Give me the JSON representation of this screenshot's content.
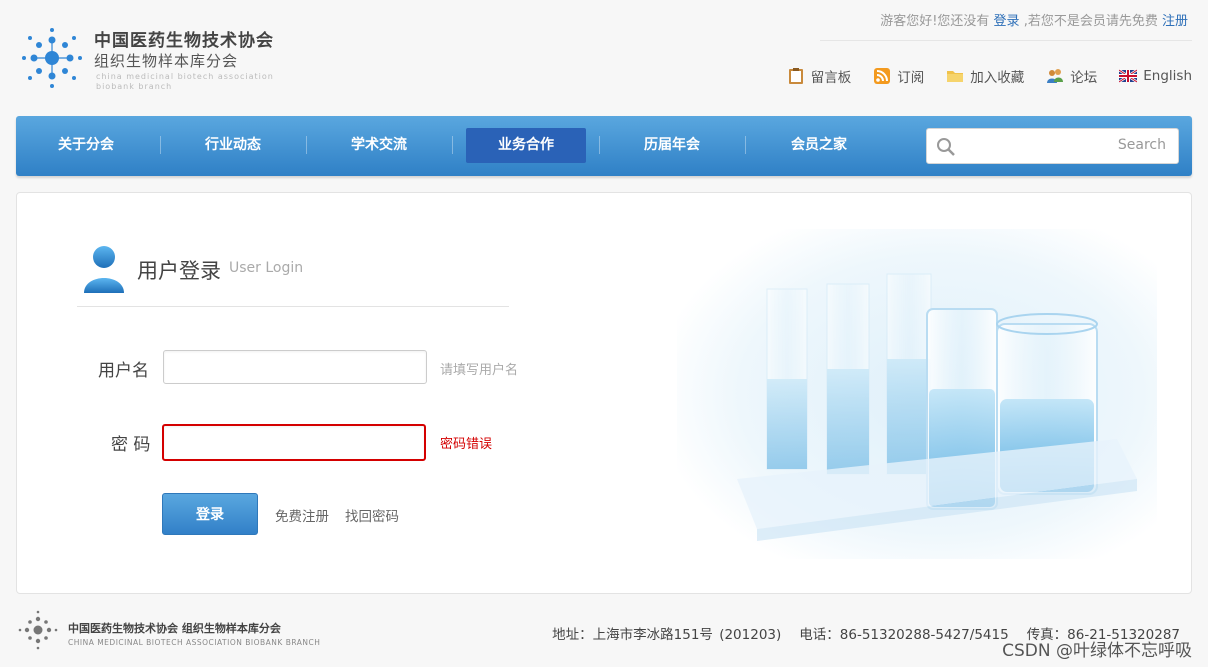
{
  "logo": {
    "cn_line1": "中国医药生物技术协会",
    "cn_line2": "组织生物样本库分会",
    "en_line1": "china medicinal biotech association",
    "en_line2": "biobank branch"
  },
  "topbar": {
    "greeting": "游客您好!您还没有",
    "login_link": "登录",
    "middle": ",若您不是会员请先免费",
    "register_link": "注册"
  },
  "toollinks": [
    {
      "label": "留言板",
      "icon": "message-board-icon"
    },
    {
      "label": "订阅",
      "icon": "rss-icon"
    },
    {
      "label": "加入收藏",
      "icon": "folder-icon"
    },
    {
      "label": "论坛",
      "icon": "forum-users-icon"
    },
    {
      "label": "English",
      "icon": "uk-flag-icon"
    }
  ],
  "nav": {
    "items": [
      "关于分会",
      "行业动态",
      "学术交流",
      "业务合作",
      "历届年会",
      "会员之家"
    ],
    "active_index": 3
  },
  "search": {
    "label": "Search",
    "value": ""
  },
  "login": {
    "title": "用户登录",
    "subtitle": "User Login",
    "username_label": "用户名",
    "username_value": "",
    "username_hint": "请填写用户名",
    "password_label": "密 码",
    "password_value": "",
    "password_error": "密码错误",
    "submit_label": "登录",
    "register_link": "免费注册",
    "forgot_link": "找回密码"
  },
  "footer": {
    "cn": "中国医药生物技术协会 组织生物样本库分会",
    "en": "CHINA MEDICINAL BIOTECH ASSOCIATION BIOBANK BRANCH",
    "address": "地址：上海市李冰路151号 (201203)",
    "phone": "电话：86-51320288-5427/5415",
    "fax": "传真：86-21-51320287",
    "watermark": "CSDN @叶绿体不忘呼吸"
  },
  "colors": {
    "brand_blue": "#2f80c6",
    "nav_active": "#2a62b7",
    "error_red": "#d40000",
    "link_blue": "#2d6fb8"
  }
}
